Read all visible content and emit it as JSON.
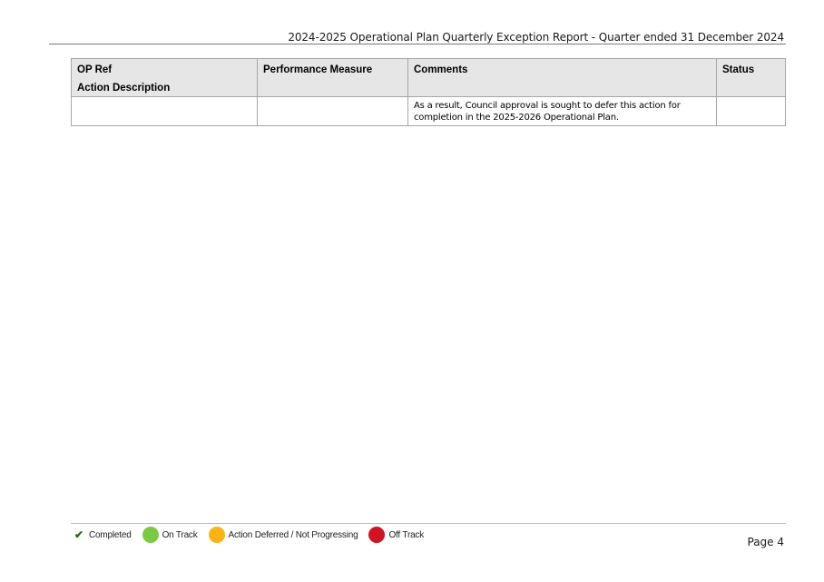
{
  "header": {
    "title": "2024-2025 Operational Plan Quarterly Exception Report - Quarter ended 31 December 2024"
  },
  "table": {
    "headers": {
      "op_ref": "OP Ref",
      "action_description": "Action Description",
      "performance_measure": "Performance Measure",
      "comments": "Comments",
      "status": "Status"
    },
    "rows": [
      {
        "op_ref": "",
        "performance_measure": "",
        "comments": "As a result, Council approval is sought to defer this action for completion in the 2025-2026 Operational Plan.",
        "status": ""
      }
    ]
  },
  "legend": {
    "items": [
      {
        "label": "Completed",
        "icon": "check-icon",
        "color": "#2a6a1b"
      },
      {
        "label": "On Track",
        "icon": "green-dot-icon",
        "color": "#7ac943"
      },
      {
        "label": "Action Deferred / Not Progressing",
        "icon": "amber-dot-icon",
        "color": "#fbb414"
      },
      {
        "label": "Off Track",
        "icon": "red-dot-icon",
        "color": "#d1141f"
      }
    ]
  },
  "footer": {
    "page": "Page 4"
  }
}
